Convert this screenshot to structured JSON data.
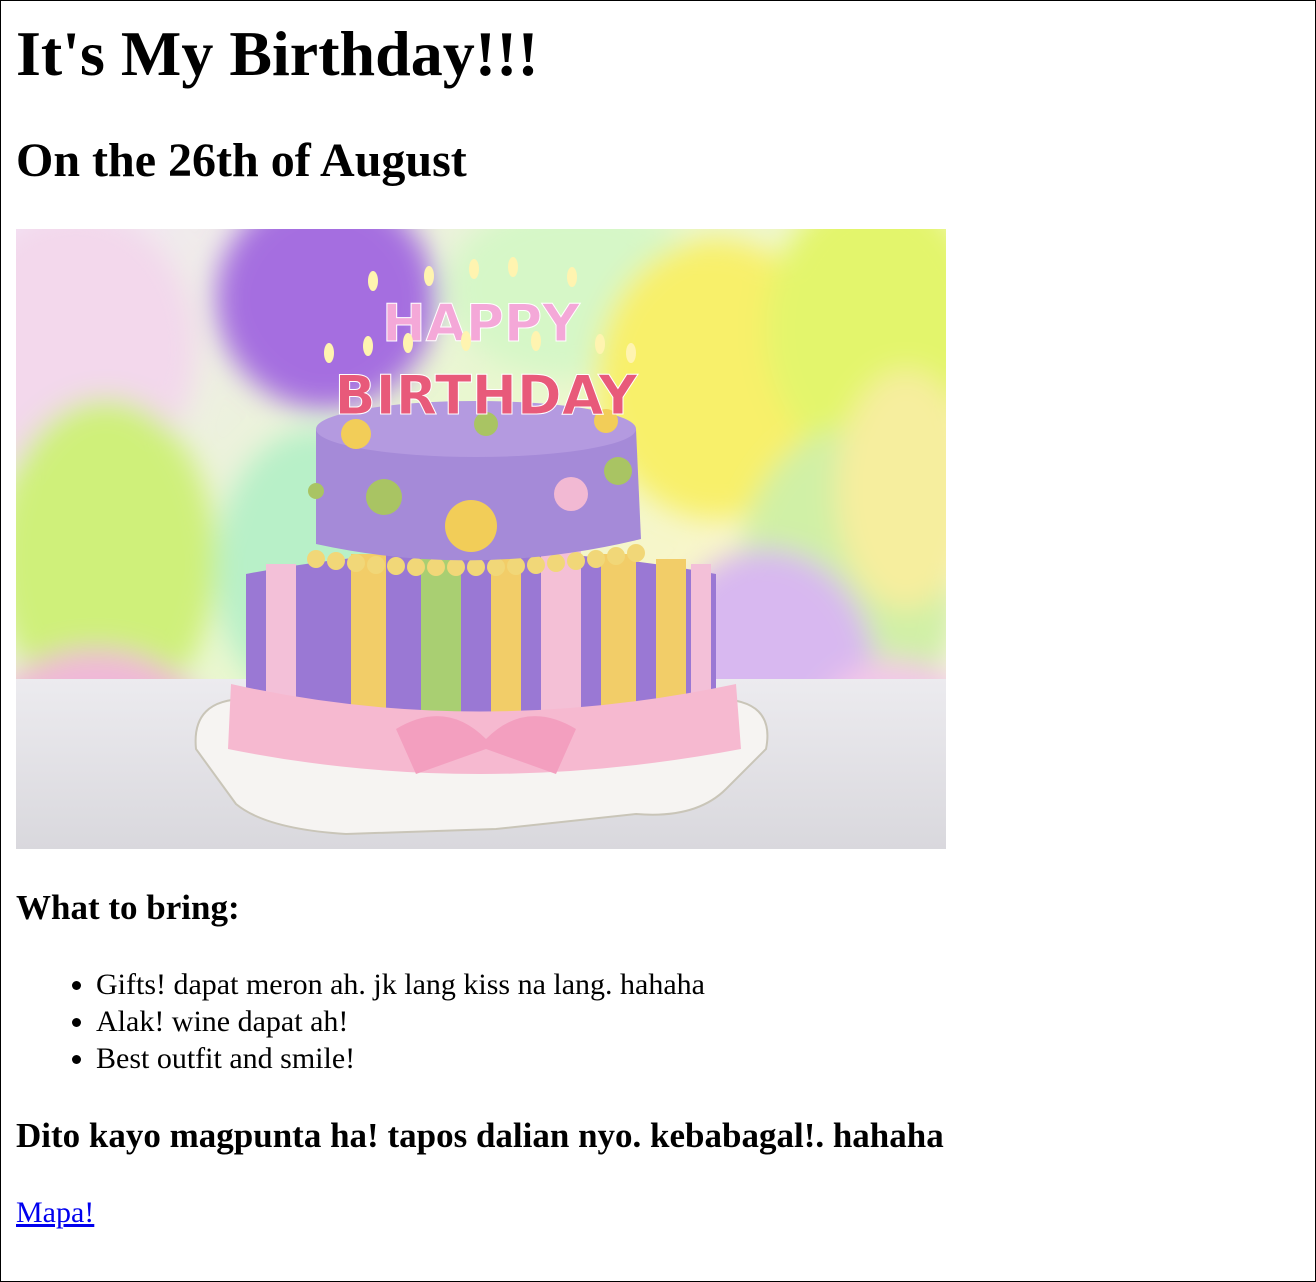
{
  "page": {
    "title": "It's My Birthday!!!",
    "subtitle": "On the 26th of August"
  },
  "image": {
    "candles_line1": "HAPPY",
    "candles_line2": "BIRTHDAY"
  },
  "bring": {
    "heading": "What to bring:",
    "items": [
      "Gifts! dapat meron ah. jk lang kiss na lang. hahaha",
      "Alak! wine dapat ah!",
      "Best outfit and smile!"
    ]
  },
  "directions": {
    "heading": "Dito kayo magpunta ha! tapos dalian nyo. kebabagal!. hahaha",
    "link_label": "Mapa!"
  },
  "colors": {
    "link": "#0000ee",
    "text": "#000000"
  }
}
